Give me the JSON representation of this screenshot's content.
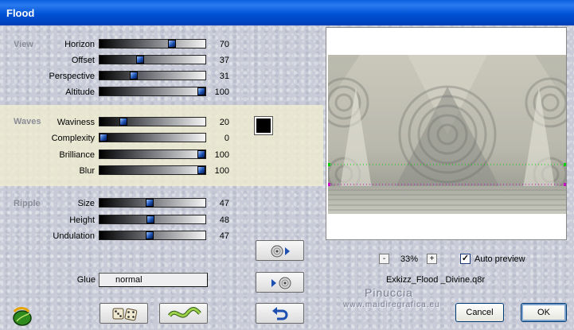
{
  "window": {
    "title": "Flood"
  },
  "view": {
    "label": "View",
    "rows": [
      {
        "label": "Horizon",
        "value": "70"
      },
      {
        "label": "Offset",
        "value": "37"
      },
      {
        "label": "Perspective",
        "value": "31"
      },
      {
        "label": "Altitude",
        "value": "100"
      }
    ]
  },
  "waves": {
    "label": "Waves",
    "rows": [
      {
        "label": "Waviness",
        "value": "20"
      },
      {
        "label": "Complexity",
        "value": "0"
      },
      {
        "label": "Brilliance",
        "value": "100"
      },
      {
        "label": "Blur",
        "value": "100"
      }
    ],
    "color": "#000000"
  },
  "ripple": {
    "label": "Ripple",
    "rows": [
      {
        "label": "Size",
        "value": "47"
      },
      {
        "label": "Height",
        "value": "48"
      },
      {
        "label": "Undulation",
        "value": "47"
      }
    ]
  },
  "glue": {
    "label": "Glue",
    "value": "normal"
  },
  "preview": {
    "zoom": "33%",
    "zoom_minus": "-",
    "zoom_plus": "+",
    "auto_preview_label": "Auto preview",
    "auto_preview_checked": true,
    "filename": "Exkizz_Flood _Divine.q8r"
  },
  "watermark": {
    "line1": "Pinuccia",
    "line2": "www.maidiregrafica.eu"
  },
  "buttons": {
    "cancel": "Cancel",
    "ok": "OK"
  },
  "icons": {
    "app": "leaf-app-icon",
    "randomize": "dice-icon",
    "reset": "wave-icon",
    "save_preset": "disc-arrow-right-icon",
    "load_preset": "arrow-disc-icon",
    "undo": "undo-icon"
  },
  "colors": {
    "title_bar": "#0052d6",
    "waves_band": "#eeecd0",
    "slider_thumb": "#1c4fb0"
  }
}
